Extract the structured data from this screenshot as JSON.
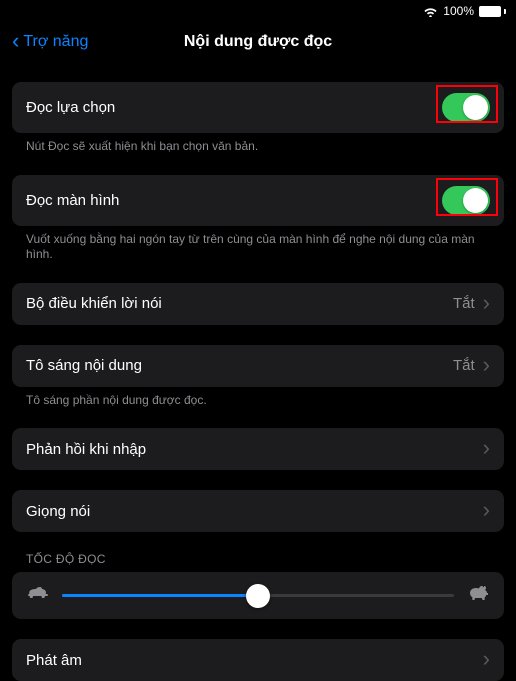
{
  "status": {
    "battery": "100%"
  },
  "nav": {
    "back": "Trợ năng",
    "title": "Nội dung được đọc"
  },
  "rows": {
    "speakSelection": {
      "label": "Đọc lựa chọn",
      "caption": "Nút Đọc sẽ xuất hiện khi bạn chọn văn bản."
    },
    "speakScreen": {
      "label": "Đọc màn hình",
      "caption": "Vuốt xuống bằng hai ngón tay từ trên cùng của màn hình để nghe nội dung của màn hình."
    },
    "speechController": {
      "label": "Bộ điều khiển lời nói",
      "value": "Tắt"
    },
    "highlightContent": {
      "label": "Tô sáng nội dung",
      "value": "Tắt",
      "caption": "Tô sáng phần nội dung được đọc."
    },
    "typingFeedback": {
      "label": "Phản hồi khi nhập"
    },
    "voices": {
      "label": "Giọng nói"
    },
    "rateHeader": "TỐC ĐỘ ĐỌC",
    "pronunciation": {
      "label": "Phát âm"
    }
  }
}
